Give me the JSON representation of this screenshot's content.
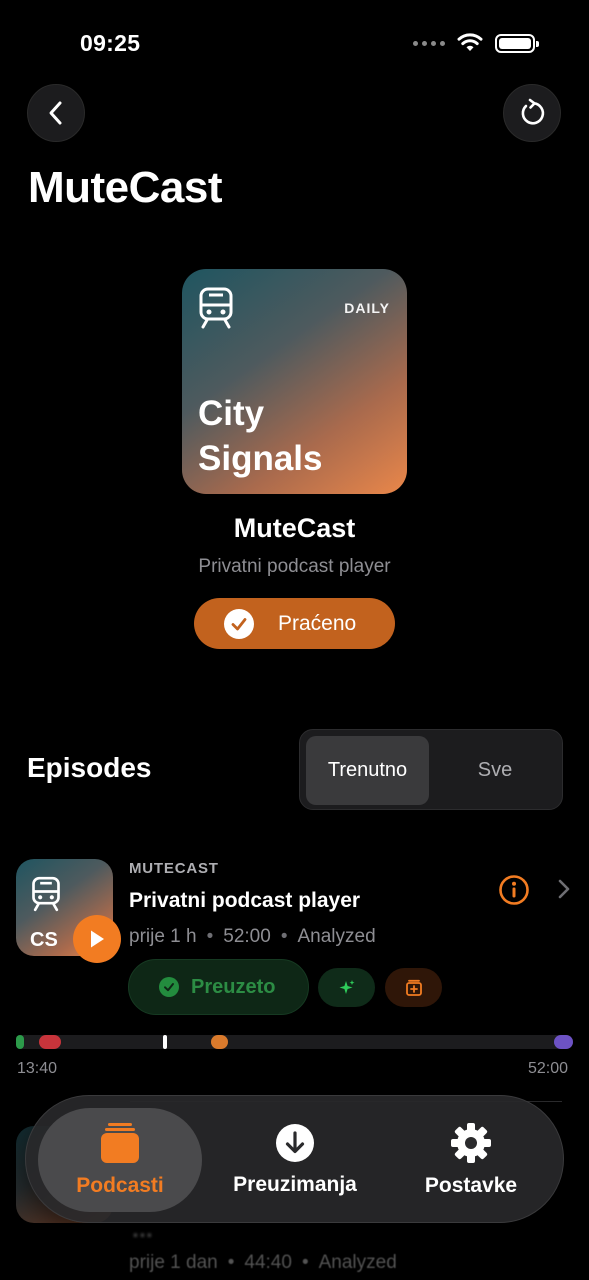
{
  "status_bar": {
    "time": "09:25"
  },
  "header": {
    "title": "MuteCast"
  },
  "artwork": {
    "tag": "DAILY",
    "title_line1": "City",
    "title_line2": "Signals",
    "icon": "train-icon"
  },
  "podcast": {
    "name": "MuteCast",
    "subtitle": "Privatni podcast player",
    "follow_label": "Praćeno"
  },
  "episodes": {
    "title": "Episodes",
    "segments": [
      "Trenutno",
      "Sve"
    ],
    "selected_segment": "Trenutno"
  },
  "episode": {
    "thumb_label": "CS",
    "channel": "MUTECAST",
    "title": "Privatni podcast player",
    "age": "prije 1 h",
    "duration": "52:00",
    "status": "Analyzed",
    "downloaded_label": "Preuzeto",
    "timeline_start": "13:40",
    "timeline_end": "52:00",
    "colors": {
      "accent": "#f27c22",
      "success": "#2c8c44"
    }
  },
  "episode_next": {
    "title": "...",
    "age": "prije 1 dan",
    "duration": "44:40",
    "status": "Analyzed"
  },
  "tabbar": {
    "podcasts": "Podcasti",
    "downloads": "Preuzimanja",
    "settings": "Postavke",
    "active": "Podcasti"
  }
}
